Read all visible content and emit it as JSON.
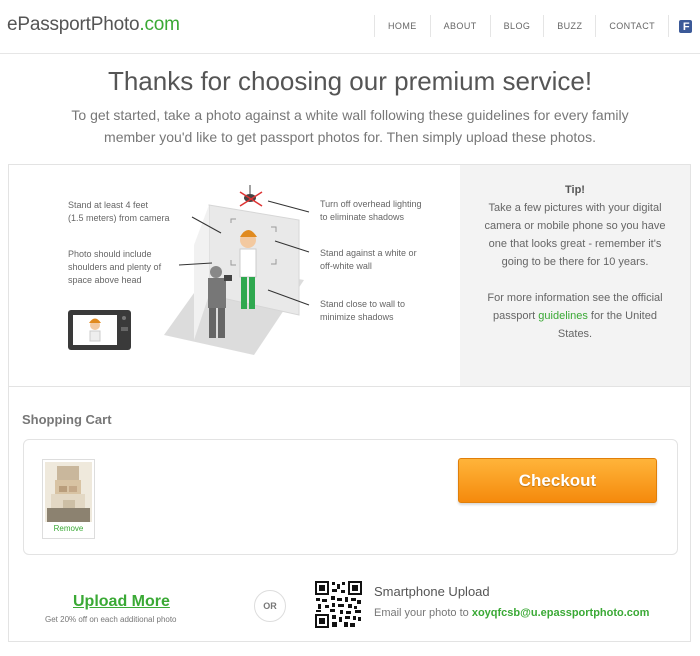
{
  "header": {
    "logo_main": "ePassportPhoto",
    "logo_suffix": ".com",
    "nav": [
      "HOME",
      "ABOUT",
      "BLOG",
      "BUZZ",
      "CONTACT"
    ],
    "facebook_letter": "f"
  },
  "hero": {
    "title": "Thanks for choosing our premium service!",
    "subtitle": "To get started, take a photo against a white wall following these guidelines for every family member you'd like to get passport photos for. Then simply upload these photos."
  },
  "guidelines": {
    "stand_distance": [
      "Stand at least 4 feet",
      "(1.5 meters) from camera"
    ],
    "photo_include": [
      "Photo should include",
      "shoulders and plenty of",
      "space above head"
    ],
    "lighting": [
      "Turn off overhead lighting",
      "to eliminate shadows"
    ],
    "wall": [
      "Stand against a white or",
      "off-white wall"
    ],
    "close": [
      "Stand close to wall to",
      "minimize shadows"
    ]
  },
  "tip": {
    "title": "Tip!",
    "body": "Take a few pictures with your digital camera or mobile phone so you have one that looks great - remember it's going to be there for 10 years.",
    "more_prefix": "For more information see the official passport ",
    "more_link": "guidelines",
    "more_suffix": " for the United States."
  },
  "cart": {
    "title": "Shopping Cart",
    "remove_label": "Remove",
    "checkout_label": "Checkout"
  },
  "upload": {
    "upload_more_label": "Upload More",
    "upload_note": "Get 20% off on each additional photo",
    "or_label": "OR",
    "smartphone_title": "Smartphone Upload",
    "email_prefix": "Email your photo to ",
    "email_address": "xoyqfcsb@u.epassportphoto.com"
  },
  "colors": {
    "brand_green": "#3aa935",
    "checkout_orange": "#f7941d",
    "facebook_blue": "#3b5998"
  },
  "icons": [
    "facebook-icon",
    "qr-code-icon",
    "camera-icon",
    "overhead-light-icon"
  ]
}
